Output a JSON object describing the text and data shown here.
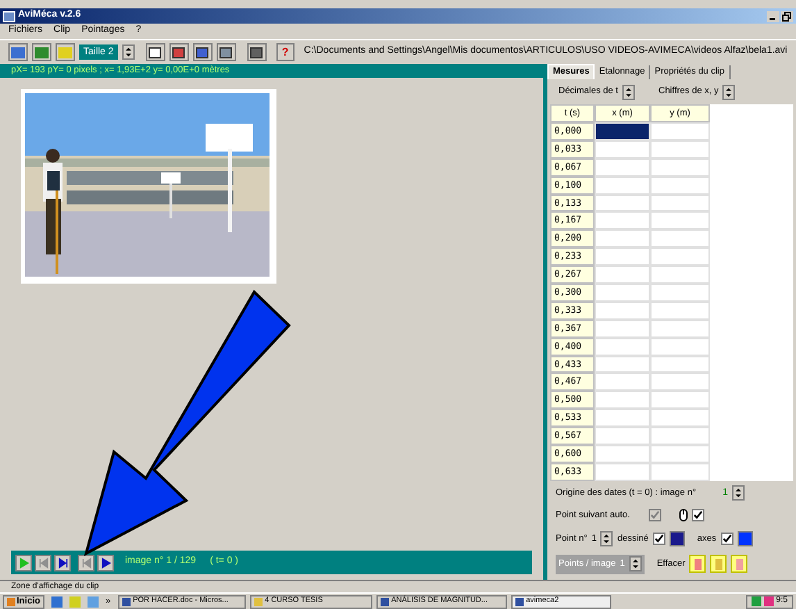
{
  "window": {
    "title": "AviMéca v.2.6"
  },
  "menu": [
    "Fichiers",
    "Clip",
    "Pointages",
    "?"
  ],
  "toolbar": {
    "size_label": "Taille 2",
    "help": "?",
    "path": "C:\\Documents and Settings\\Angel\\Mis documentos\\ARTICULOS\\USO VIDEOS-AVIMECA\\videos Alfaz\\bela1.avi"
  },
  "coordinates": "pX= 193  pY= 0 pixels  ;  x= 1,93E+2  y= 0,00E+0 mètres",
  "tabs": [
    {
      "label": "Mesures",
      "selected": true
    },
    {
      "label": "Etalonnage",
      "selected": false
    },
    {
      "label": "Propriétés du clip",
      "selected": false
    }
  ],
  "decimals": [
    "Décimales de t",
    "Chiffres de x, y"
  ],
  "table": {
    "columns": [
      "t (s)",
      "x (m)",
      "y (m)"
    ],
    "rows": [
      {
        "t": "0,000",
        "selected": true
      },
      {
        "t": "0,033",
        "selected": false
      },
      {
        "t": "0,067",
        "selected": false
      },
      {
        "t": "0,100",
        "selected": false
      },
      {
        "t": "0,133",
        "selected": false
      },
      {
        "t": "0,167",
        "selected": false
      },
      {
        "t": "0,200",
        "selected": false
      },
      {
        "t": "0,233",
        "selected": false
      },
      {
        "t": "0,267",
        "selected": false
      },
      {
        "t": "0,300",
        "selected": false
      },
      {
        "t": "0,333",
        "selected": false
      },
      {
        "t": "0,367",
        "selected": false
      },
      {
        "t": "0,400",
        "selected": false
      },
      {
        "t": "0,433",
        "selected": false
      },
      {
        "t": "0,467",
        "selected": false
      },
      {
        "t": "0,500",
        "selected": false
      },
      {
        "t": "0,533",
        "selected": false
      },
      {
        "t": "0,567",
        "selected": false
      },
      {
        "t": "0,600",
        "selected": false
      },
      {
        "t": "0,633",
        "selected": false
      }
    ]
  },
  "origin": {
    "label": "Origine des dates (t = 0) : image n°",
    "value": "1"
  },
  "auto_point": {
    "label": "Point suivant auto.",
    "checked": true,
    "disabled": true,
    "cursor_checked": true
  },
  "point": {
    "label": "Point n°",
    "value": "1",
    "drawn_label": "dessiné",
    "drawn": true,
    "axes_label": "axes",
    "axes": true
  },
  "points_per_image": {
    "label": "Points / image",
    "value": "1",
    "disabled": true
  },
  "erase": {
    "label": "Effacer"
  },
  "player": {
    "frame": "image n° 1 / 129",
    "time": "( t= 0 )"
  },
  "status": "Zone d'affichage du clip",
  "taskbar": {
    "start": "Inicio",
    "more": "»",
    "tasks": [
      {
        "label": "POR HACER.doc - Micros...",
        "selected": false
      },
      {
        "label": "4 CURSO TESIS",
        "selected": false
      },
      {
        "label": "ANÁLISIS DE MAGNITUD...",
        "selected": false
      },
      {
        "label": "avimeca2",
        "selected": true
      }
    ],
    "clock": "9:5"
  }
}
